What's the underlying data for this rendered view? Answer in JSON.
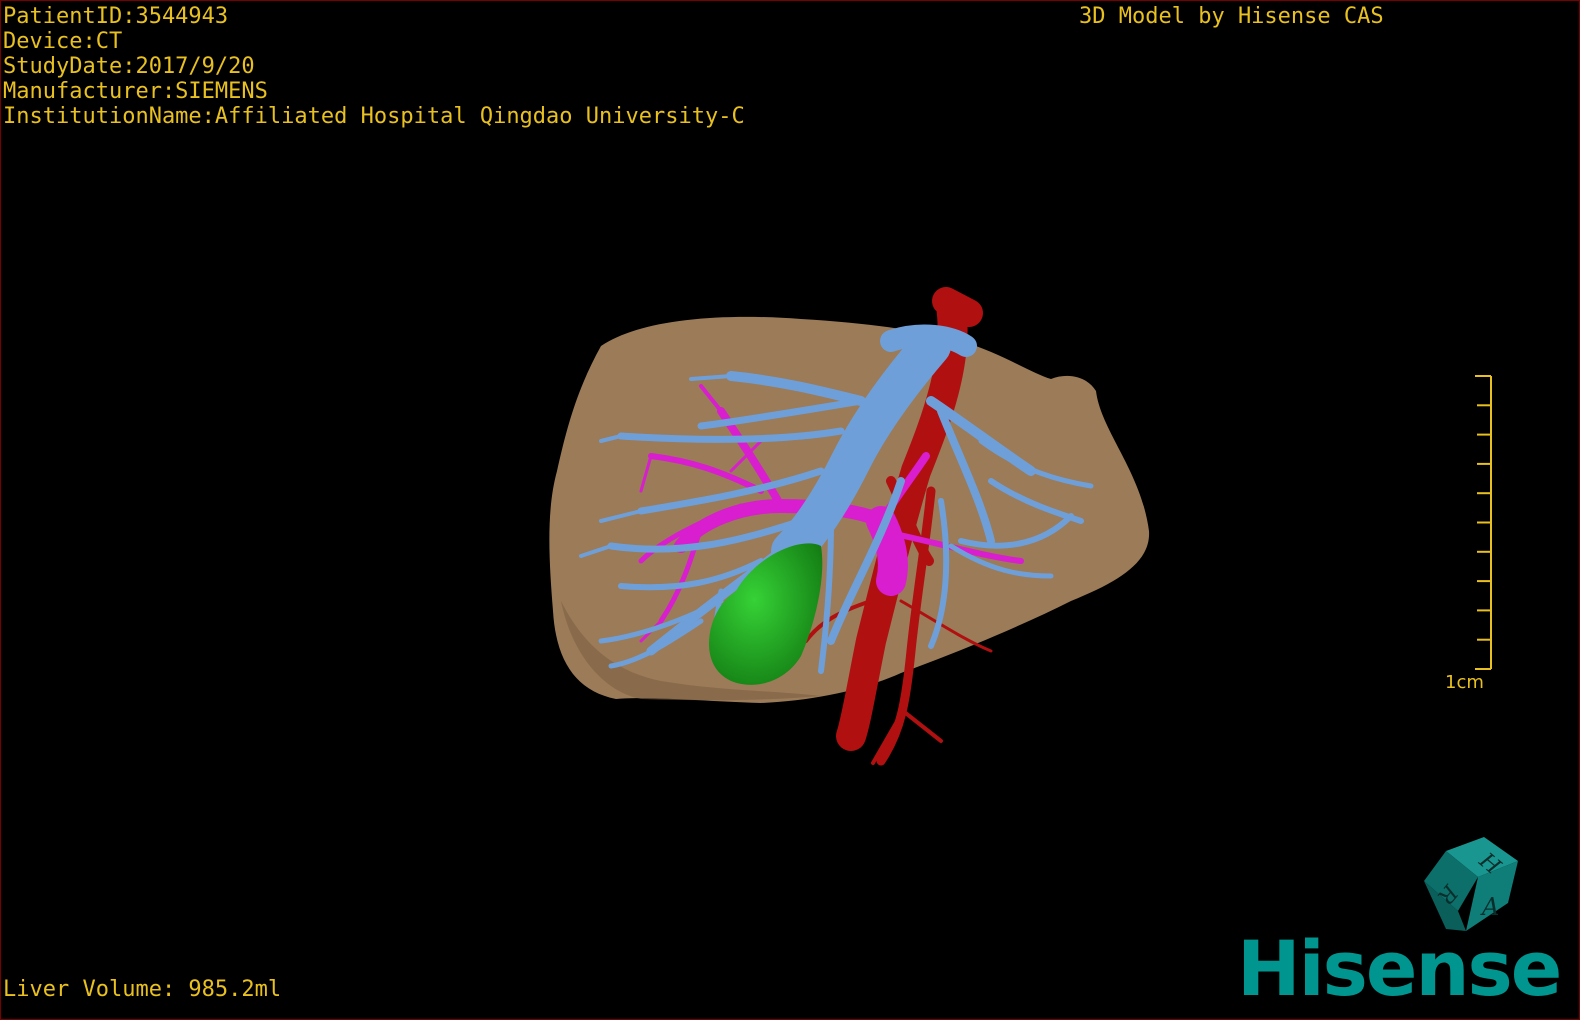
{
  "patient_info": {
    "patient_id": "PatientID:3544943",
    "device": "Device:CT",
    "study_date": "StudyDate:2017/9/20",
    "manufacturer": "Manufacturer:SIEMENS",
    "institution": "InstitutionName:Affiliated Hospital Qingdao University-C"
  },
  "model_credit": "3D Model by Hisense CAS",
  "liver_volume": "Liver Volume: 985.2ml",
  "scale": {
    "label": "1cm",
    "ticks": 10
  },
  "orientation_cube": {
    "faces": [
      "H",
      "R",
      "A"
    ]
  },
  "brand": "Hisense",
  "colors": {
    "overlay_text": "#e8c020",
    "liver": "#9b7b58",
    "hepatic_vein": "#6f9fd8",
    "portal_vein": "#d81ecf",
    "artery": "#b01010",
    "gallbladder": "#1ea81e",
    "brand": "#00968f",
    "cube": "#0f7d78",
    "viewport_border": "#7a0000"
  },
  "structures": {
    "liver": "liver-surface",
    "hepatic_vein": "hepatic-vein-tree",
    "portal_vein": "portal-vein-tree",
    "artery": "arterial-tree",
    "gallbladder": "gallbladder"
  }
}
